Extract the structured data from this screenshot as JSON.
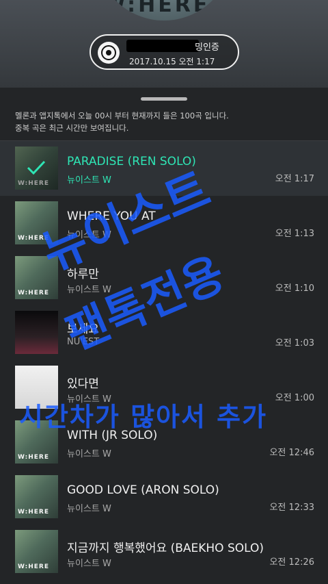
{
  "header": {
    "album_disc_text": "W:HERE",
    "status": "밍인증",
    "timestamp": "2017.10.15 오전 1:17"
  },
  "info": {
    "line1": "멜론과 앱지톡에서 오늘 00시 부터 현재까지 들은 100곡 입니다.",
    "line2": "중복 곡은 최근 시간만 보여집니다."
  },
  "tracks": [
    {
      "title": "PARADISE (REN SOLO)",
      "artist": "뉴이스트 W",
      "time": "오전 1:17",
      "selected": true,
      "thumb": "W:HERE"
    },
    {
      "title": "WHERE YOU AT",
      "artist": "뉴이스트 W",
      "time": "오전 1:13",
      "thumb": "W:HERE"
    },
    {
      "title": "하루만",
      "artist": "뉴이스트 W",
      "time": "오전 1:10",
      "thumb": "W:HERE"
    },
    {
      "title": "보세요",
      "artist": "NU'EST",
      "time": "오전 1:03",
      "thumb": ""
    },
    {
      "title": "있다면",
      "artist": "뉴이스트 W",
      "time": "오전 1:00",
      "thumb": ""
    },
    {
      "title": "WITH (JR SOLO)",
      "artist": "뉴이스트 W",
      "time": "오전 12:46",
      "thumb": "W:HERE"
    },
    {
      "title": "GOOD LOVE (ARON SOLO)",
      "artist": "뉴이스트 W",
      "time": "오전 12:33",
      "thumb": "W:HERE"
    },
    {
      "title": "지금까지 행복했어요 (BAEKHO SOLO)",
      "artist": "뉴이스트 W",
      "time": "오전 12:26",
      "thumb": "W:HERE"
    }
  ],
  "watermark": {
    "line1": "뉴이스트",
    "line2": "팬톡전용",
    "line3": "시간차가 많아서 추가"
  },
  "colors": {
    "accent": "#2ee6b5",
    "watermark": "#1a5cff"
  }
}
